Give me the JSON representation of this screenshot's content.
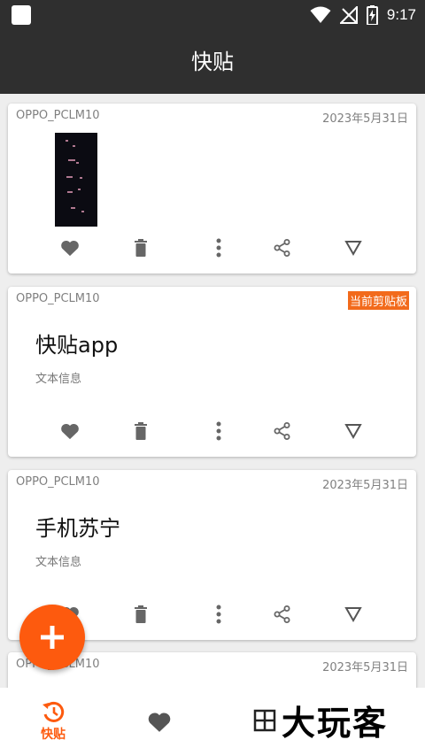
{
  "status_bar": {
    "time": "9:17"
  },
  "app_bar": {
    "title": "快贴"
  },
  "cards": [
    {
      "device": "OPPO_PCLM10",
      "date": "2023年5月31日",
      "kind": "image"
    },
    {
      "device": "OPPO_PCLM10",
      "badge": "当前剪贴板",
      "text": "快贴app",
      "sub": "文本信息",
      "kind": "text"
    },
    {
      "device": "OPPO_PCLM10",
      "date": "2023年5月31日",
      "text": "手机苏宁",
      "sub": "文本信息",
      "kind": "text"
    },
    {
      "device": "OPPO_PCLM10",
      "date": "2023年5月31日",
      "kind": "partial"
    }
  ],
  "bottom_nav": {
    "items": [
      {
        "label": "快贴",
        "icon": "history-icon",
        "active": true
      },
      {
        "label": "",
        "icon": "heart-icon"
      }
    ]
  },
  "watermark": {
    "text": "大玩客"
  },
  "colors": {
    "accent": "#fd5a0e",
    "appbar": "#2f2f2f",
    "badge": "#f26a1b",
    "icon": "#666666"
  }
}
